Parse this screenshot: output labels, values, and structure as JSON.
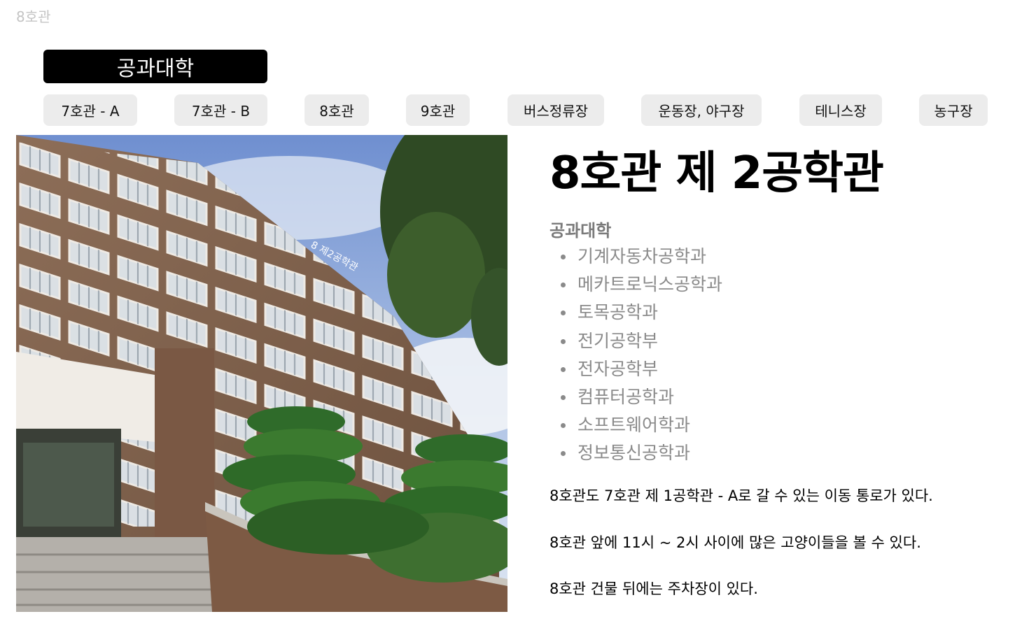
{
  "page": {
    "corner_title": "8호관"
  },
  "college_button": {
    "label": "공과대학"
  },
  "nav": {
    "items": [
      {
        "label": "7호관  - A"
      },
      {
        "label": "7호관  - B"
      },
      {
        "label": "8호관"
      },
      {
        "label": "9호관"
      },
      {
        "label": "버스정류장"
      },
      {
        "label": "운동장, 야구장"
      },
      {
        "label": "테니스장"
      },
      {
        "label": "농구장"
      }
    ]
  },
  "detail": {
    "title": "8호관 제 2공학관",
    "college": "공과대학",
    "departments": [
      "기계자동차공학과",
      "메카트로닉스공학과",
      "토목공학과",
      "전기공학부",
      "전자공학부",
      "컴퓨터공학과",
      "소프트웨어학과",
      "정보통신공학과"
    ],
    "notes": [
      "8호관도 7호관 제 1공학관 - A로 갈 수 있는 이동 통로가 있다.",
      "8호관 앞에 11시 ~ 2시 사이에 많은 고양이들을 볼 수 있다.",
      "8호관 건물 뒤에는 주차장이 있다."
    ],
    "photo": {
      "icon": "building-photo",
      "sign_text": "8 제2공학관"
    }
  },
  "colors": {
    "accent": "#000000",
    "nav_bg": "#ececec",
    "muted_text": "#8a8a8a",
    "faint_text": "#c4c4c4"
  }
}
